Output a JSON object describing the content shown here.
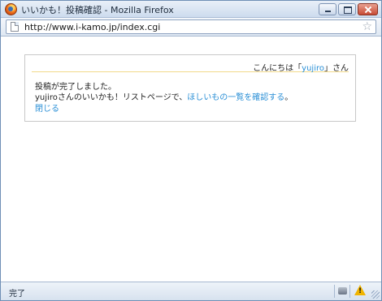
{
  "window": {
    "title": "いいかも！投稿確認 - Mozilla Firefox",
    "buttons": {
      "minimize": "minimize",
      "maximize": "maximize",
      "close": "close"
    }
  },
  "navigation": {
    "url": "http://www.i-kamo.jp/index.cgi"
  },
  "page": {
    "greeting": {
      "prefix": "こんにちは「",
      "user": "yujiro",
      "suffix": "」さん"
    },
    "message": {
      "line1": "投稿が完了しました。",
      "line2_prefix": "yujiroさんのいいかも！リストページで、",
      "line2_link": "ほしいもの一覧を確認する",
      "line2_suffix": "。",
      "close_link": "閉じる"
    }
  },
  "statusbar": {
    "text": "完了"
  },
  "colors": {
    "link": "#2a8fd6",
    "chrome": "#dfe8f3",
    "greeting_rule": "#f2d98a",
    "warning": "#f0b400"
  },
  "icons": [
    "firefox-icon",
    "page-icon",
    "bookmark-star-icon",
    "addon-icon",
    "warning-icon"
  ]
}
